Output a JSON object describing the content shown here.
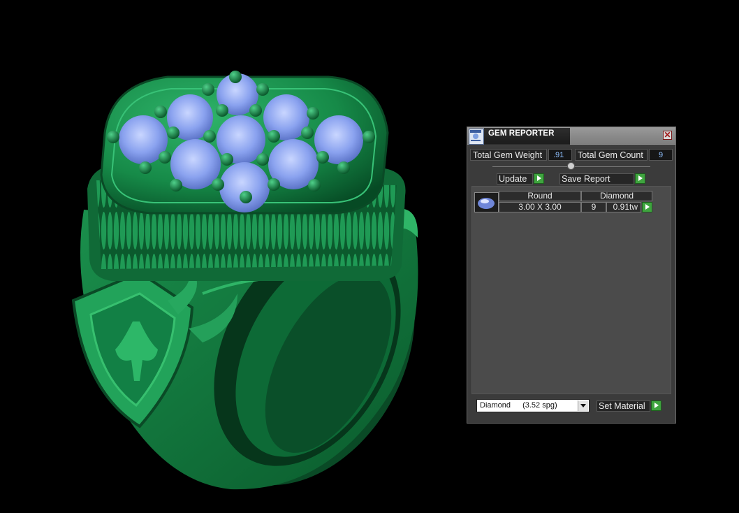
{
  "panel": {
    "title": "GEM REPORTER",
    "close_glyph": "✕",
    "icon": "gem-reporter-app-icon",
    "total_gem_weight_label": "Total Gem Weight",
    "total_gem_weight_value": ".91",
    "total_gem_count_label": "Total Gem Count",
    "total_gem_count_value": "9",
    "update_label": "Update",
    "save_report_label": "Save Report",
    "report": {
      "shape": "Round",
      "material": "Diamond",
      "size": "3.00 X 3.00",
      "count": "9",
      "weight": "0.91tw"
    },
    "material_select": {
      "name": "Diamond",
      "spg": "(3.52 spg)"
    },
    "set_material_label": "Set Material"
  },
  "colors": {
    "ring_green": "#1f8a50",
    "ring_dark": "#0a3d22",
    "gem_blue": "#8fa9f0",
    "panel_bg": "#3b3b3b",
    "accent_green": "#3fa43f",
    "value_text": "#8fc0ff"
  }
}
